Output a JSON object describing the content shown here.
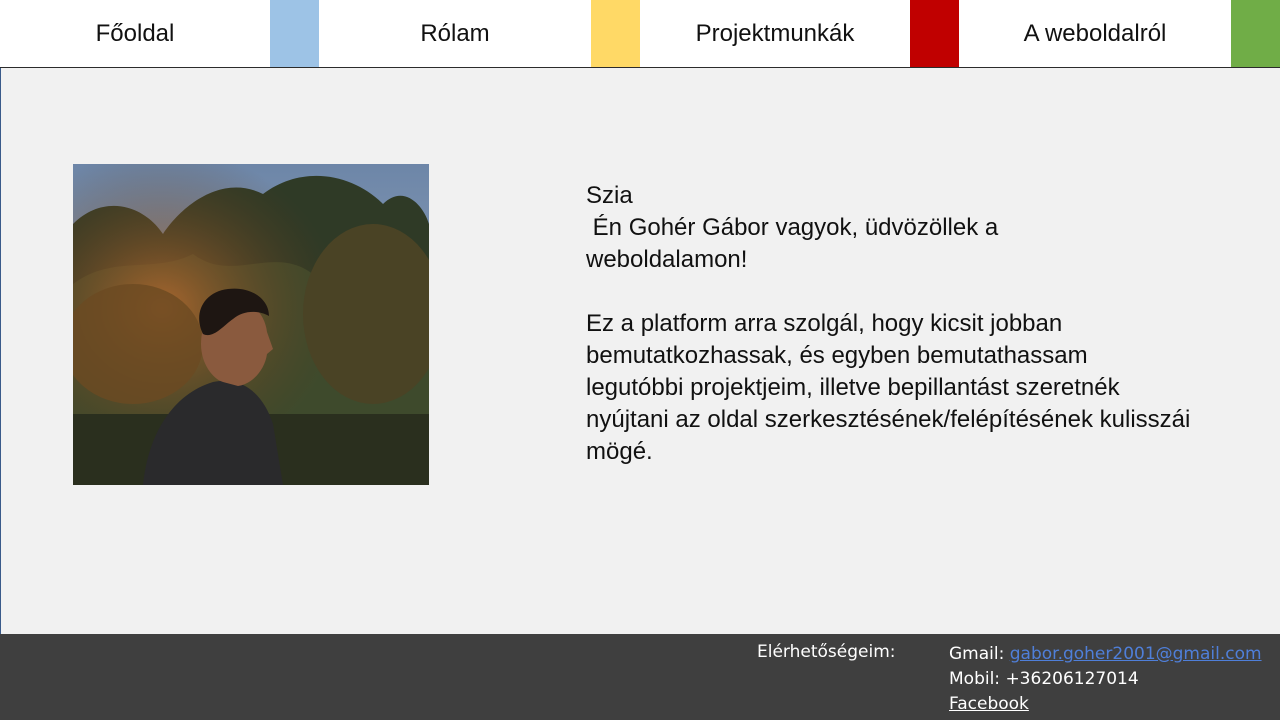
{
  "nav": {
    "items": [
      {
        "label": "Főoldal"
      },
      {
        "label": "Rólam"
      },
      {
        "label": "Projektmunkák"
      },
      {
        "label": "A weboldalról"
      }
    ],
    "swatch_colors": [
      "#9dc3e6",
      "#ffd966",
      "#c00000",
      "#70ad47"
    ]
  },
  "intro": {
    "greeting": "Szia",
    "line1": " Én Gohér Gábor vagyok, üdvözöllek a weboldalamon!",
    "paragraph": "Ez a platform arra szolgál, hogy kicsit jobban bemutatkozhassak, és egyben bemutathassam legutóbbi projektjeim, illetve bepillantást szeretnék nyújtani az oldal szerkesztésének/felépítésének kulisszái mögé."
  },
  "footer": {
    "heading": "Elérhetőségeim:",
    "gmail_label": "Gmail: ",
    "gmail_value": "gabor.goher2001@gmail.com",
    "mobile_label": "Mobil: ",
    "mobile_value": "+36206127014",
    "facebook": "Facebook"
  }
}
